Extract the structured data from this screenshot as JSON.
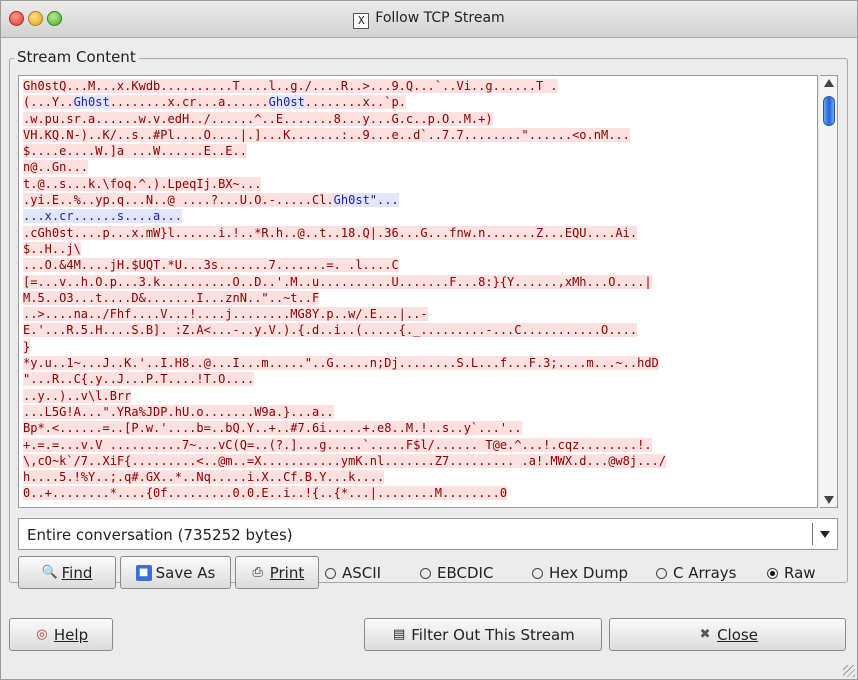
{
  "window": {
    "title": "Follow TCP Stream"
  },
  "stream_group_label": "Stream Content",
  "stream_lines": [
    {
      "c": "Gh0stQ...M...x.Kwdb..........T....l..g./....R..>...9.Q...`..Vi..g......T ."
    },
    {
      "c": "(...Y..",
      "s": "Gh0st",
      "c2": "........x.cr...a......",
      "s2": "Gh0st",
      "c3": "........x..`p."
    },
    {
      "c": ".w.pu.sr.a......w.v.edH../......^..E.......8...y...G.c..p.O..M.+)"
    },
    {
      "c": "VH.KQ.N-)..K/..s..#Pl....O....|.]...K.......:..9...e..d`..7.7........\"......<o.nM..."
    },
    {
      "c": "$....e....W.]a ...W......E..E.."
    },
    {
      "c": "n@..Gn..."
    },
    {
      "c": "t.@..s...k.\\foq.^.).LpeqIj.BX~..."
    },
    {
      "c": ".yi.E..%..yp.q...N..@ ....?...U.O.-.....Cl.",
      "s": "Gh0st\"..."
    },
    {
      "s": "...x.cr......s....a..."
    },
    {
      "c": ".cGh0st....p...x.mW}l......i.!..*R.h..@..t..18.Q|.36...G...fnw.n.......Z...EQU....Ai."
    },
    {
      "c": "$..H..j\\"
    },
    {
      "c": "...O.&4M....jH.$UQT.*U...3s.......7.......=. .l....C"
    },
    {
      "c": "[=...v..h.O.p...3.k..........O..D..'.M..u..........U.......F...8:}{Y......,xMh...O....|"
    },
    {
      "c": "M.5..O3...t....D&.......I...znN..\"..~t..F"
    },
    {
      "c": "..>....na../Fhf....V...!....j........MG8Y.p..w/.E...|..-"
    },
    {
      "c": "E.'...R.5.H....S.B]. :Z.A<...-..y.V.).{.d..i..(.....{._.........-...C...........O...."
    },
    {
      "c": "}"
    },
    {
      "c": "*y.u..1~...J..K.'..I.H8..@...I...m.....\"..G.....n;Dj........S.L...f...F.3;....m...~..hdD"
    },
    {
      "c": "\"...R..C{.y..J...P.T....!T.O...."
    },
    {
      "c": "..y..)..v\\l.Brr"
    },
    {
      "c": "...L5G!A...\".YRa%JDP.hU.o.......W9a.}...a.."
    },
    {
      "c": "Bp*.<......=..[P.w.'....b=..bQ.Y..+..#7.6i.....+.e8..M.!..s..y`...'.."
    },
    {
      "c": "+.=.=...v.V ..........7~...vC(Q=..(?.]...g.....`.....F$l/...... T@e.^...!.cqz........!."
    },
    {
      "c": "\\,cO~k`/7..XiF{.........<..@m..=X...........ymK.nl.......Z7......... .a!.MWX.d...@w8j.../"
    },
    {
      "c": "h....5.!%Y..;.q#.GX..*..Nq.....i.X..Cf.B.Y...k...."
    },
    {
      "c": "0..+........*....{0f.........0.0.E..i..!{..{*...|........M........0"
    }
  ],
  "conversation_select": {
    "value": "Entire conversation (735252 bytes)"
  },
  "buttons": {
    "find": "Find",
    "save_as": "Save As",
    "print": "Print",
    "help": "Help",
    "filter_out": "Filter Out This Stream",
    "close": "Close"
  },
  "radios": [
    {
      "label": "ASCII",
      "checked": false
    },
    {
      "label": "EBCDIC",
      "checked": false
    },
    {
      "label": "Hex Dump",
      "checked": false
    },
    {
      "label": "C Arrays",
      "checked": false
    },
    {
      "label": "Raw",
      "checked": true
    }
  ],
  "icons": {
    "find": "magnifier-icon",
    "save_as": "floppy-disk-icon",
    "print": "printer-icon",
    "help": "lifebuoy-icon",
    "filter": "filter-document-icon",
    "close": "x-close-icon",
    "title": "x11-window-icon"
  }
}
